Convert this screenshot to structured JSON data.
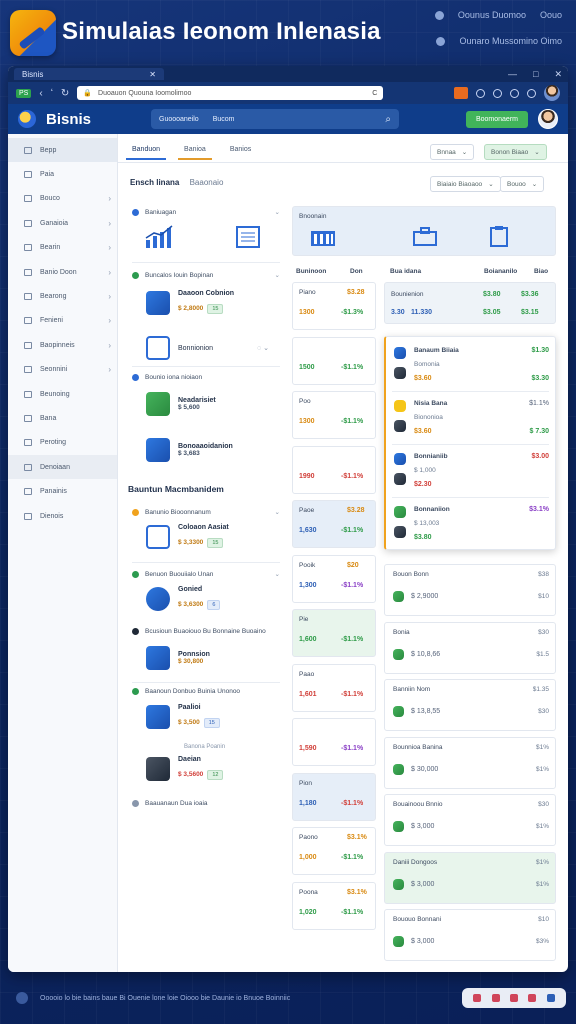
{
  "header": {
    "title": "Simulaias Ieonom Inlenasia",
    "top_right_1": "Oounus Duomoo",
    "top_right_1b": "Oouo",
    "top_right_2": "Ounaro Mussomino Oimo"
  },
  "browser": {
    "tab_label": "Bisnis",
    "tab_close": "✕",
    "window_controls": [
      "—",
      "□",
      "✕"
    ],
    "mini_brand": "PS",
    "nav_forward": "ʻ",
    "url_text": "Duoauon Quouna Ioomolimoo",
    "url_end": "C"
  },
  "appbar": {
    "name": "Bisnis",
    "search_left": "Guoooaneilo",
    "search_right": "Bucom",
    "cta": "Boomonaerm"
  },
  "sidebar": {
    "items": [
      {
        "label": "Bepp",
        "chevron": false,
        "state": "active"
      },
      {
        "label": "Paia",
        "chevron": false,
        "state": ""
      },
      {
        "label": "Bouco",
        "chevron": true,
        "state": ""
      },
      {
        "label": "Ganaioia",
        "chevron": true,
        "state": ""
      },
      {
        "label": "Bearin",
        "chevron": true,
        "state": ""
      },
      {
        "label": "Banio Doon",
        "chevron": true,
        "state": ""
      },
      {
        "label": "Bearong",
        "chevron": true,
        "state": ""
      },
      {
        "label": "Fenieni",
        "chevron": true,
        "state": ""
      },
      {
        "label": "Baopinneis",
        "chevron": true,
        "state": ""
      },
      {
        "label": "Seonnini",
        "chevron": true,
        "state": ""
      },
      {
        "label": "Beunoing",
        "chevron": false,
        "state": ""
      },
      {
        "label": "Bana",
        "chevron": false,
        "state": ""
      },
      {
        "label": "Peroting",
        "chevron": false,
        "state": ""
      },
      {
        "label": "Denoiaan",
        "chevron": false,
        "state": "hi"
      },
      {
        "label": "Panainis",
        "chevron": false,
        "state": ""
      },
      {
        "label": "Dienois",
        "chevron": false,
        "state": ""
      }
    ]
  },
  "tabs": [
    "Banduon",
    "Banioa",
    "Banios"
  ],
  "filters": {
    "a": "Bnnaa",
    "b": "Bonon Biaao",
    "c": "Biaiaio Biaoaoo",
    "d": "Bouoo"
  },
  "section_main": {
    "title": "Ensch linana",
    "sub": "Baaonaio"
  },
  "left_list": {
    "g1_header": "Baniuagan",
    "g2_header": "Buncalos Iouin Bopinan",
    "item1": {
      "title": "Daaoon Cobnion",
      "value": "$ 2,8000",
      "tag": "15"
    },
    "item2": {
      "title": "Bonnionion",
      "value": ""
    },
    "g3_header": "Bounio iona nioiaon",
    "item3": {
      "title": "Neadarisiet",
      "value": "$ 5,600"
    },
    "item4": {
      "title": "Bonoaaoidanion",
      "value": "$ 3,683"
    },
    "section2_title": "Bauntun Macmbanidem",
    "g4_header": "Banunio Biooonnanum",
    "item5": {
      "title": "Coloaon Aasiat",
      "value": "$ 3,3300",
      "tag": "15"
    },
    "g5_header": "Benuon Buouiialo Unan",
    "item6": {
      "title": "Gonied",
      "value": "$ 3,6300",
      "tag": "6"
    },
    "g6_header": "Bcusioun Buaoiouo Bu Bonnaine Buoaino",
    "item7": {
      "title": "Ponnsion",
      "value": "$ 30,800"
    },
    "g7_header": "Baanoun Donbuo Buinia Unonoo",
    "item8": {
      "title": "Paalioi",
      "value": "$ 3,500",
      "tag": "15"
    },
    "item8b_hdr": "Banona Poanin",
    "item9": {
      "title": "Daeian",
      "value": "$ 3,5600",
      "tag": "12"
    },
    "footer_item": "Baauanaun Dua ioaia"
  },
  "mid": {
    "kpi_label": "Bnoonain",
    "col_headers": [
      "Buninoon",
      "Don"
    ],
    "rows": [
      {
        "label": "Piano",
        "v1": "1300",
        "v2": "$3.28",
        "v3": "-$1.3%",
        "c1": "orange",
        "c3": "green"
      },
      {
        "label": "",
        "v1": "1500",
        "v2": "",
        "v3": "-$1.1%",
        "c1": "green",
        "c3": "green"
      },
      {
        "label": "Poo",
        "v1": "1300",
        "v2": "",
        "v3": "-$1.1%",
        "c1": "orange",
        "c3": "green"
      },
      {
        "label": "",
        "v1": "1990",
        "v2": "",
        "v3": "-$1.1%",
        "c1": "red",
        "c3": "red"
      },
      {
        "label": "Paoe",
        "v1": "1,630",
        "v2": "$3.28",
        "v3": "-$1.1%",
        "c1": "blue",
        "c3": "green"
      },
      {
        "label": "Pooik",
        "v1": "1,300",
        "v2": "$20",
        "v3": "-$1.1%",
        "c1": "blue",
        "c3": "purple"
      },
      {
        "label": "Pie",
        "v1": "1,600",
        "v2": "",
        "v3": "-$1.1%",
        "c1": "green",
        "c3": "green"
      },
      {
        "label": "Paao",
        "v1": "1,601",
        "v2": "",
        "v3": "-$1.1%",
        "c1": "red",
        "c3": "red"
      },
      {
        "label": "",
        "v1": "1,590",
        "v2": "",
        "v3": "-$1.1%",
        "c1": "red",
        "c3": "purple"
      },
      {
        "label": "Pion",
        "v1": "1,180",
        "v2": "",
        "v3": "-$1.1%",
        "c1": "blue",
        "c3": "red"
      },
      {
        "label": "Paono",
        "v1": "1,000",
        "v2": "$3.1%",
        "v3": "-$1.1%",
        "c1": "orange",
        "c3": "green"
      },
      {
        "label": "Poona",
        "v1": "1,020",
        "v2": "$3.1%",
        "v3": "-$1.1%",
        "c1": "green",
        "c3": "green"
      }
    ]
  },
  "right": {
    "kpi_label": "Daiaolonan",
    "col_headers": [
      "Bua idana",
      "Boiananilo",
      "Biao"
    ],
    "top_row": {
      "label": "Bounienion",
      "v1": "$3.80",
      "v2": "$3.36",
      "n1": "3.30",
      "n2": "11.330",
      "v3": "$3.05",
      "v4": "$3.15"
    },
    "popup_items": [
      {
        "title": "Banaum Biiaia",
        "sub": "Bomonia",
        "v1": "$3.60",
        "v2": "$3.30",
        "v3": "$1.30"
      },
      {
        "title": "Nisia Bana",
        "sub": "Biononioa",
        "v1": "$3.60",
        "v2": "$ 7.30",
        "v3": "$1.1%"
      },
      {
        "title": "Bonnianiib",
        "sub": "$ 1,000",
        "v1": "$2.30",
        "v2": "",
        "v3": "$3.00"
      },
      {
        "title": "Bonnaniion",
        "sub": "$ 13,003",
        "v1": "$3.80",
        "v2": "",
        "v3": "$3.1%"
      }
    ],
    "list": [
      {
        "title": "Bouon Bonn",
        "value": "$ 2,9000",
        "s1": "$38",
        "s2": "$10"
      },
      {
        "title": "Bonia",
        "value": "$ 10,8,66",
        "s1": "$30",
        "s2": "$1.5"
      },
      {
        "title": "Banniin Nom",
        "value": "$ 13,8,55",
        "s1": "$1.35",
        "s2": "$30"
      },
      {
        "title": "Bounnioa Banina",
        "value": "$ 30,000",
        "s1": "$1%",
        "s2": "$1%"
      },
      {
        "title": "Bouainoou Bnnio",
        "value": "$ 3,000",
        "s1": "$30",
        "s2": "$1%"
      },
      {
        "title": "Daniii Dongoos",
        "value": "$ 3,000",
        "s1": "$1%",
        "s2": "$1%"
      },
      {
        "title": "Bououo Bonnani",
        "value": "$ 3,000",
        "s1": "$10",
        "s2": "$3%"
      }
    ]
  },
  "footer": {
    "text": "Ooooio lo bie bains baue Bi Ouenie lone loie Oiooo bie Daunie io Bnuoe Boinniic"
  }
}
